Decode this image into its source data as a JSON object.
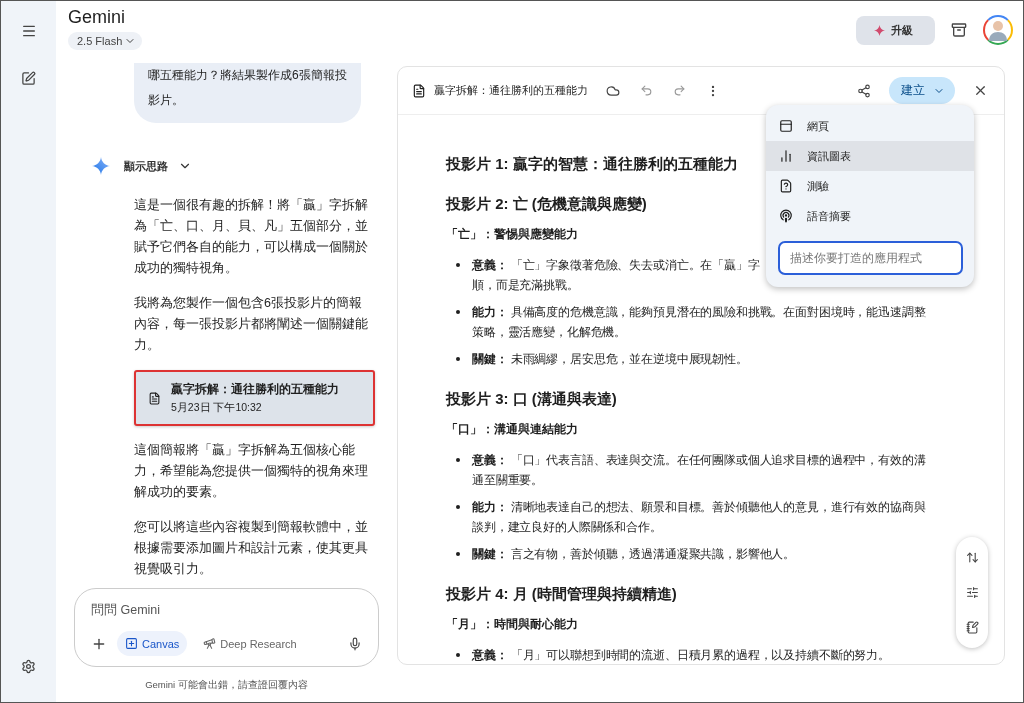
{
  "header": {
    "title": "Gemini",
    "model": "2.5 Flash",
    "upgrade": "升級"
  },
  "chat": {
    "user_lines": [
      "哪五種能力？將結果製作成6張簡報投",
      "影片。"
    ],
    "thoughts": "顯示思路",
    "paragraphs_before": [
      "這是一個很有趣的拆解！將「贏」字拆解為「亡、口、月、貝、凡」五個部分，並賦予它們各自的能力，可以構成一個關於成功的獨特視角。",
      "我將為您製作一個包含6張投影片的簡報內容，每一張投影片都將闡述一個關鍵能力。"
    ],
    "doc_card": {
      "title": "贏字拆解：通往勝利的五種能力",
      "date": "5月23日 下午10:32",
      "selected": true
    },
    "paragraphs_after": [
      "這個簡報將「贏」字拆解為五個核心能力，希望能為您提供一個獨特的視角來理解成功的要素。",
      "您可以將這些內容複製到簡報軟體中，並根據需要添加圖片和設計元素，使其更具視覺吸引力。"
    ]
  },
  "composer": {
    "placeholder": "問問 Gemini",
    "tools": [
      {
        "label": "Canvas",
        "selected": true
      },
      {
        "label": "Deep Research",
        "selected": false
      }
    ]
  },
  "disclaimer": "Gemini 可能會出錯，請查證回覆內容",
  "canvas": {
    "title": "贏字拆解：通往勝利的五種能力",
    "create_button": "建立",
    "menu": {
      "items": [
        {
          "kind": "webpage",
          "label": "網頁",
          "selected": false
        },
        {
          "kind": "infographic",
          "label": "資訊圖表",
          "selected": true
        },
        {
          "kind": "quiz",
          "label": "測驗",
          "selected": false
        },
        {
          "kind": "audio",
          "label": "語音摘要",
          "selected": false
        }
      ],
      "placeholder": "描述你要打造的應用程式"
    },
    "sections": [
      {
        "heading": "投影片 1: 贏字的智慧：通往勝利的五種能力"
      },
      {
        "heading": "投影片 2: 亡 (危機意識與應變)",
        "subheading": "「亡」：警惕與應變能力",
        "bullets": [
          {
            "term": "意義：",
            "lines": [
              "「亡」字象徵著危險、失去或消亡。在「贏」字",
              "順，而是充滿挑戰。"
            ]
          },
          {
            "term": "能力：",
            "lines": [
              "具備高度的危機意識，能夠預見潛在的風險和挑戰。在面對困境時，能迅速調整",
              "策略，靈活應變，化解危機。"
            ]
          },
          {
            "term": "關鍵：",
            "lines": [
              "未雨綢繆，居安思危，並在逆境中展現韌性。"
            ]
          }
        ]
      },
      {
        "heading": "投影片 3: 口 (溝通與表達)",
        "subheading": "「口」：溝通與連結能力",
        "bullets": [
          {
            "term": "意義：",
            "lines": [
              "「口」代表言語、表達與交流。在任何團隊或個人追求目標的過程中，有效的溝",
              "通至關重要。"
            ]
          },
          {
            "term": "能力：",
            "lines": [
              "清晰地表達自己的想法、願景和目標。善於傾聽他人的意見，進行有效的協商與",
              "談判，建立良好的人際關係和合作。"
            ]
          },
          {
            "term": "關鍵：",
            "lines": [
              "言之有物，善於傾聽，透過溝通凝聚共識，影響他人。"
            ]
          }
        ]
      },
      {
        "heading": "投影片 4: 月 (時間管理與持續精進)",
        "subheading": "「月」：時間與耐心能力",
        "bullets": [
          {
            "term": "意義：",
            "lines": [
              "「月」可以聯想到時間的流逝、日積月累的過程，以及持續不斷的努力。"
            ]
          }
        ]
      }
    ]
  }
}
